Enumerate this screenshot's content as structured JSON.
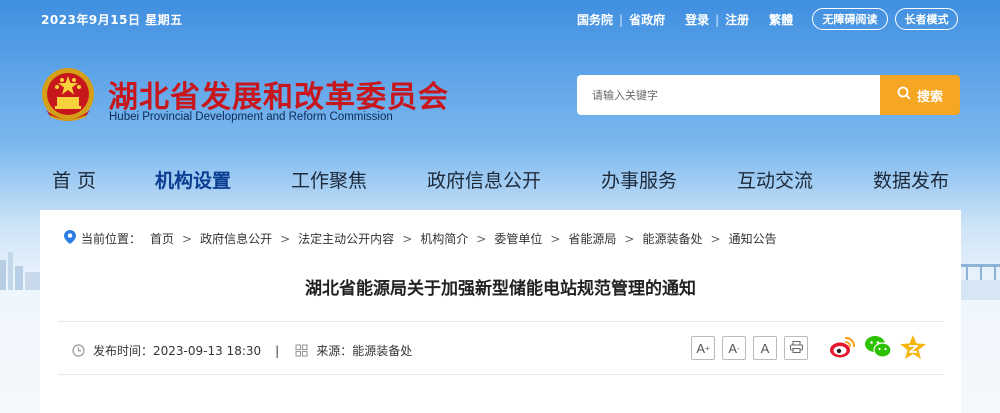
{
  "topbar": {
    "date": "2023年9月15日 星期五",
    "links": [
      "国务院",
      "省政府"
    ],
    "auth": [
      "登录",
      "注册"
    ],
    "lang": "繁體",
    "accessible": "无障碍阅读",
    "elder": "长者模式"
  },
  "header": {
    "title": "湖北省发展和改革委员会",
    "subtitle": "Hubei Provincial Development and Reform Commission",
    "search_placeholder": "请输入关键字",
    "search_label": "搜索"
  },
  "nav": {
    "items": [
      "首 页",
      "机构设置",
      "工作聚焦",
      "政府信息公开",
      "办事服务",
      "互动交流",
      "数据发布"
    ],
    "active": "机构设置"
  },
  "breadcrumb": {
    "label": "当前位置：",
    "items": [
      "首页",
      "政府信息公开",
      "法定主动公开内容",
      "机构简介",
      "委管单位",
      "省能源局",
      "能源装备处",
      "通知公告"
    ]
  },
  "article": {
    "title": "湖北省能源局关于加强新型储能电站规范管理的通知",
    "publish_label": "发布时间：2023-09-13 18:30",
    "divider": "|",
    "source_label": "来源：能源装备处"
  },
  "tools": {
    "font_large": "A",
    "font_medium": "A",
    "font_small": "A"
  },
  "colors": {
    "title_red": "#c8161d",
    "search_orange": "#f5a623",
    "nav_active": "#0b3d91"
  }
}
